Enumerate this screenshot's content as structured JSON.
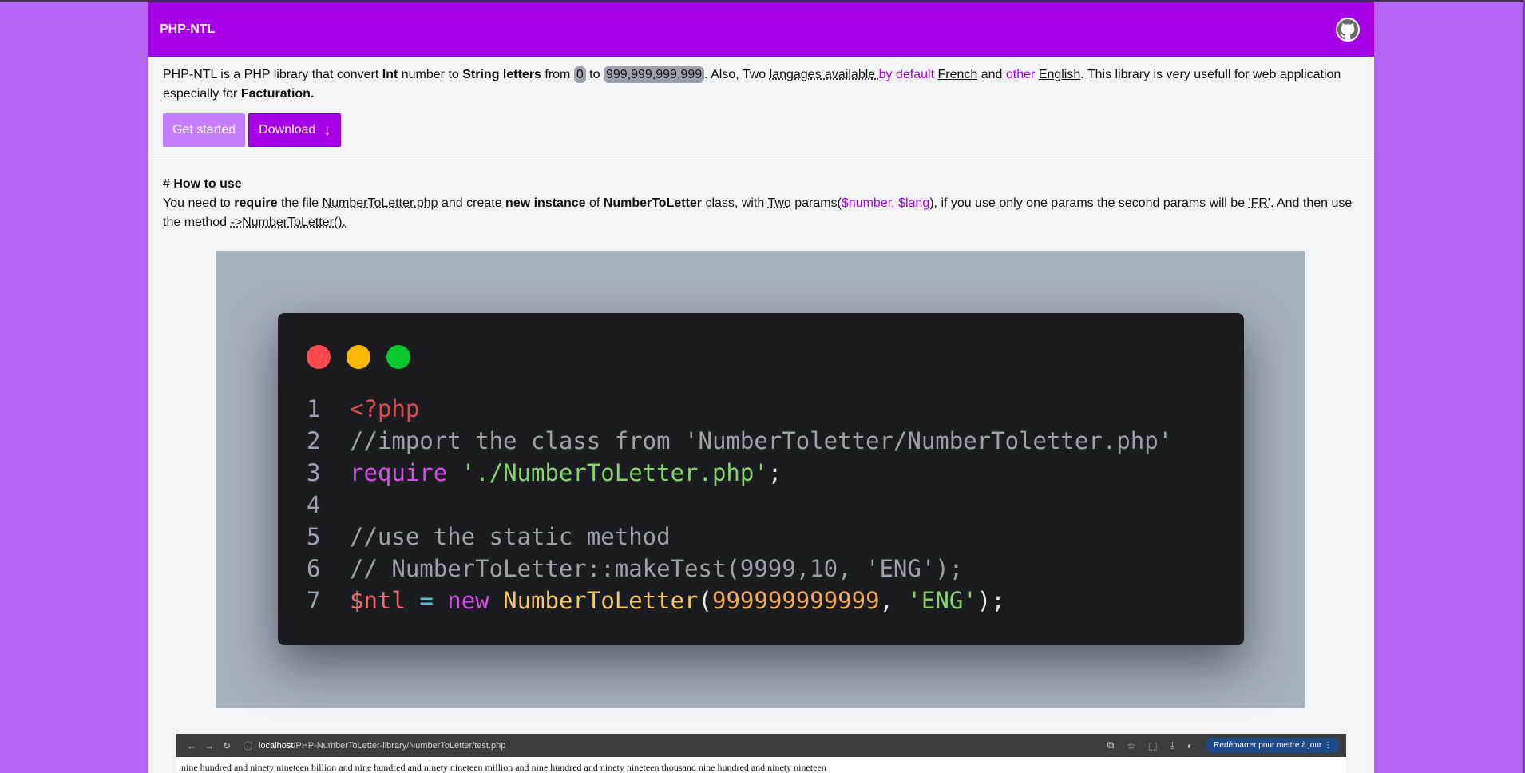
{
  "navbar": {
    "brand": "PHP-NTL",
    "github_icon": "github-icon"
  },
  "intro": {
    "t1": "PHP-NTL is a PHP library that convert ",
    "int": "Int",
    "t2": " number to ",
    "string_letters": "String letters",
    "t3": " from ",
    "min": "0",
    "t4": " to ",
    "max": "999,999,999,999",
    "t5": ". Also, Two ",
    "langages": "langages available ",
    "by_default": "by default",
    "t6": " ",
    "french": "French",
    "t7": " and ",
    "other": "other",
    "t8": " ",
    "english": "English",
    "t9": ". This library is very usefull for web application especially for ",
    "facturation": "Facturation."
  },
  "buttons": {
    "get_started": "Get started",
    "download": "Download",
    "download_icon": "arrow-down-icon"
  },
  "howto": {
    "hash": "# ",
    "title": "How to use",
    "t1": "You need to ",
    "require": "require",
    "t2": " the file ",
    "file": "NumberToLetter.php",
    "t3": " and create ",
    "new_instance": "new instance",
    "t4": " of ",
    "class": "NumberToLetter",
    "t5": " class, with ",
    "two": "Two",
    "t6": " params(",
    "params": "$number, $lang",
    "t7": "), if you use only one params the second params will be ",
    "fr": "'FR'",
    "t8": ". And then use the method ",
    "method": "->NumberToLetter()."
  },
  "code": {
    "lines": [
      {
        "n": "1",
        "tokens": [
          {
            "t": "<?php",
            "c": "kw-red"
          }
        ]
      },
      {
        "n": "2",
        "tokens": [
          {
            "t": "//import the class from 'NumberToletter/NumberToletter.php'",
            "c": "cm"
          }
        ]
      },
      {
        "n": "3",
        "tokens": [
          {
            "t": "require",
            "c": "kw"
          },
          {
            "t": " ",
            "c": "punc"
          },
          {
            "t": "'./NumberToLetter.php'",
            "c": "str"
          },
          {
            "t": ";",
            "c": "punc"
          }
        ]
      },
      {
        "n": "4",
        "tokens": []
      },
      {
        "n": "5",
        "tokens": [
          {
            "t": "//use the static method",
            "c": "cm"
          }
        ]
      },
      {
        "n": "6",
        "tokens": [
          {
            "t": "// NumberToLetter::makeTest(9999,10, 'ENG');",
            "c": "cm"
          }
        ]
      },
      {
        "n": "7",
        "tokens": [
          {
            "t": "$ntl",
            "c": "var"
          },
          {
            "t": " ",
            "c": "punc"
          },
          {
            "t": "=",
            "c": "op"
          },
          {
            "t": " ",
            "c": "punc"
          },
          {
            "t": "new",
            "c": "kw"
          },
          {
            "t": " ",
            "c": "punc"
          },
          {
            "t": "NumberToLetter",
            "c": "cls"
          },
          {
            "t": "(",
            "c": "punc"
          },
          {
            "t": "999999999999",
            "c": "num"
          },
          {
            "t": ", ",
            "c": "punc"
          },
          {
            "t": "'ENG'",
            "c": "str"
          },
          {
            "t": ");",
            "c": "punc"
          }
        ]
      }
    ]
  },
  "browser": {
    "host": "localhost",
    "path": "/PHP-NumberToLetter-library/NumberToLetter/test.php",
    "update_button": "Redémarrer pour mettre à jour",
    "output_text": "nine hundred and ninety nineteen billion and nine hundred and ninety nineteen million and nine hundred and ninety nineteen thousand nine hundred and ninety nineteen"
  }
}
